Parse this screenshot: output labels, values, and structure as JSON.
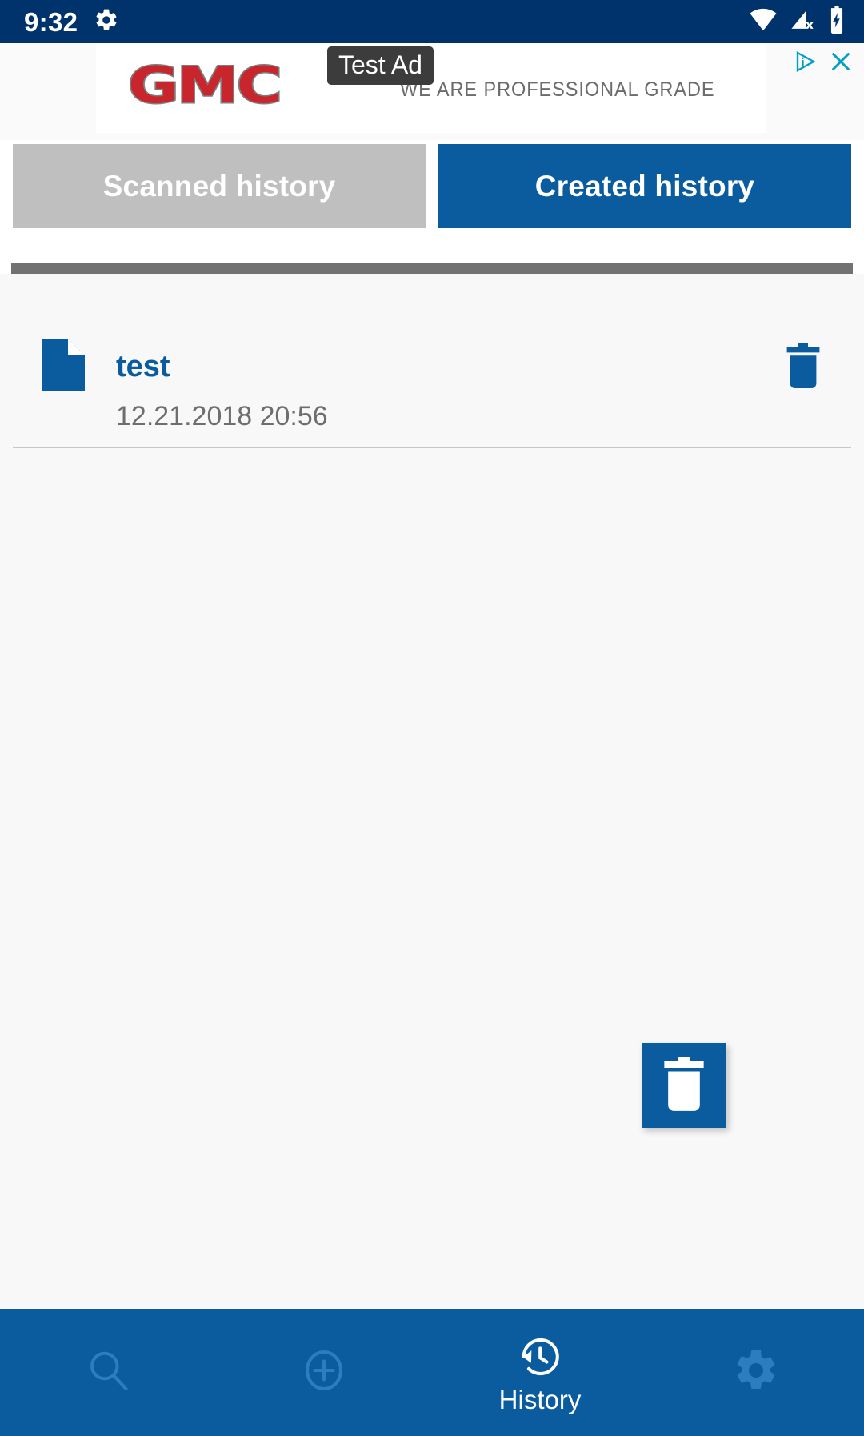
{
  "status_bar": {
    "time": "9:32",
    "background_color": "#00336b",
    "icons": [
      {
        "name": "settings-gear-icon",
        "position": "left"
      },
      {
        "name": "wifi-icon",
        "position": "right"
      },
      {
        "name": "cellular-signal-off-icon",
        "position": "right"
      },
      {
        "name": "battery-charging-icon",
        "position": "right"
      }
    ]
  },
  "ad_banner": {
    "brand": "GMC",
    "tagline": "WE ARE PROFESSIONAL GRADE",
    "test_badge": "Test Ad",
    "brand_color": "#c8252c",
    "adchoices_icon": "adchoices-icon",
    "close_icon": "close-icon",
    "control_color": "#00a0c6"
  },
  "tabs": [
    {
      "label": "Scanned history",
      "active": false,
      "color": "#bfbfbf"
    },
    {
      "label": "Created history",
      "active": true,
      "color": "#0a5c9e"
    }
  ],
  "history_list": {
    "items": [
      {
        "title": "test",
        "date": "12.21.2018 20:56",
        "file_icon": "document-icon",
        "delete_icon": "trash-icon"
      }
    ]
  },
  "fab": {
    "icon": "trash-icon",
    "label": "delete-all",
    "color": "#0a5c9e"
  },
  "bottom_nav": {
    "background_color": "#0a5c9e",
    "active_color": "#ffffff",
    "inactive_color": "#2a7ec0",
    "items": [
      {
        "icon": "search-icon",
        "label": "",
        "active": false
      },
      {
        "icon": "add-circle-icon",
        "label": "",
        "active": false
      },
      {
        "icon": "history-icon",
        "label": "History",
        "active": true
      },
      {
        "icon": "settings-gear-icon",
        "label": "",
        "active": false
      }
    ]
  }
}
